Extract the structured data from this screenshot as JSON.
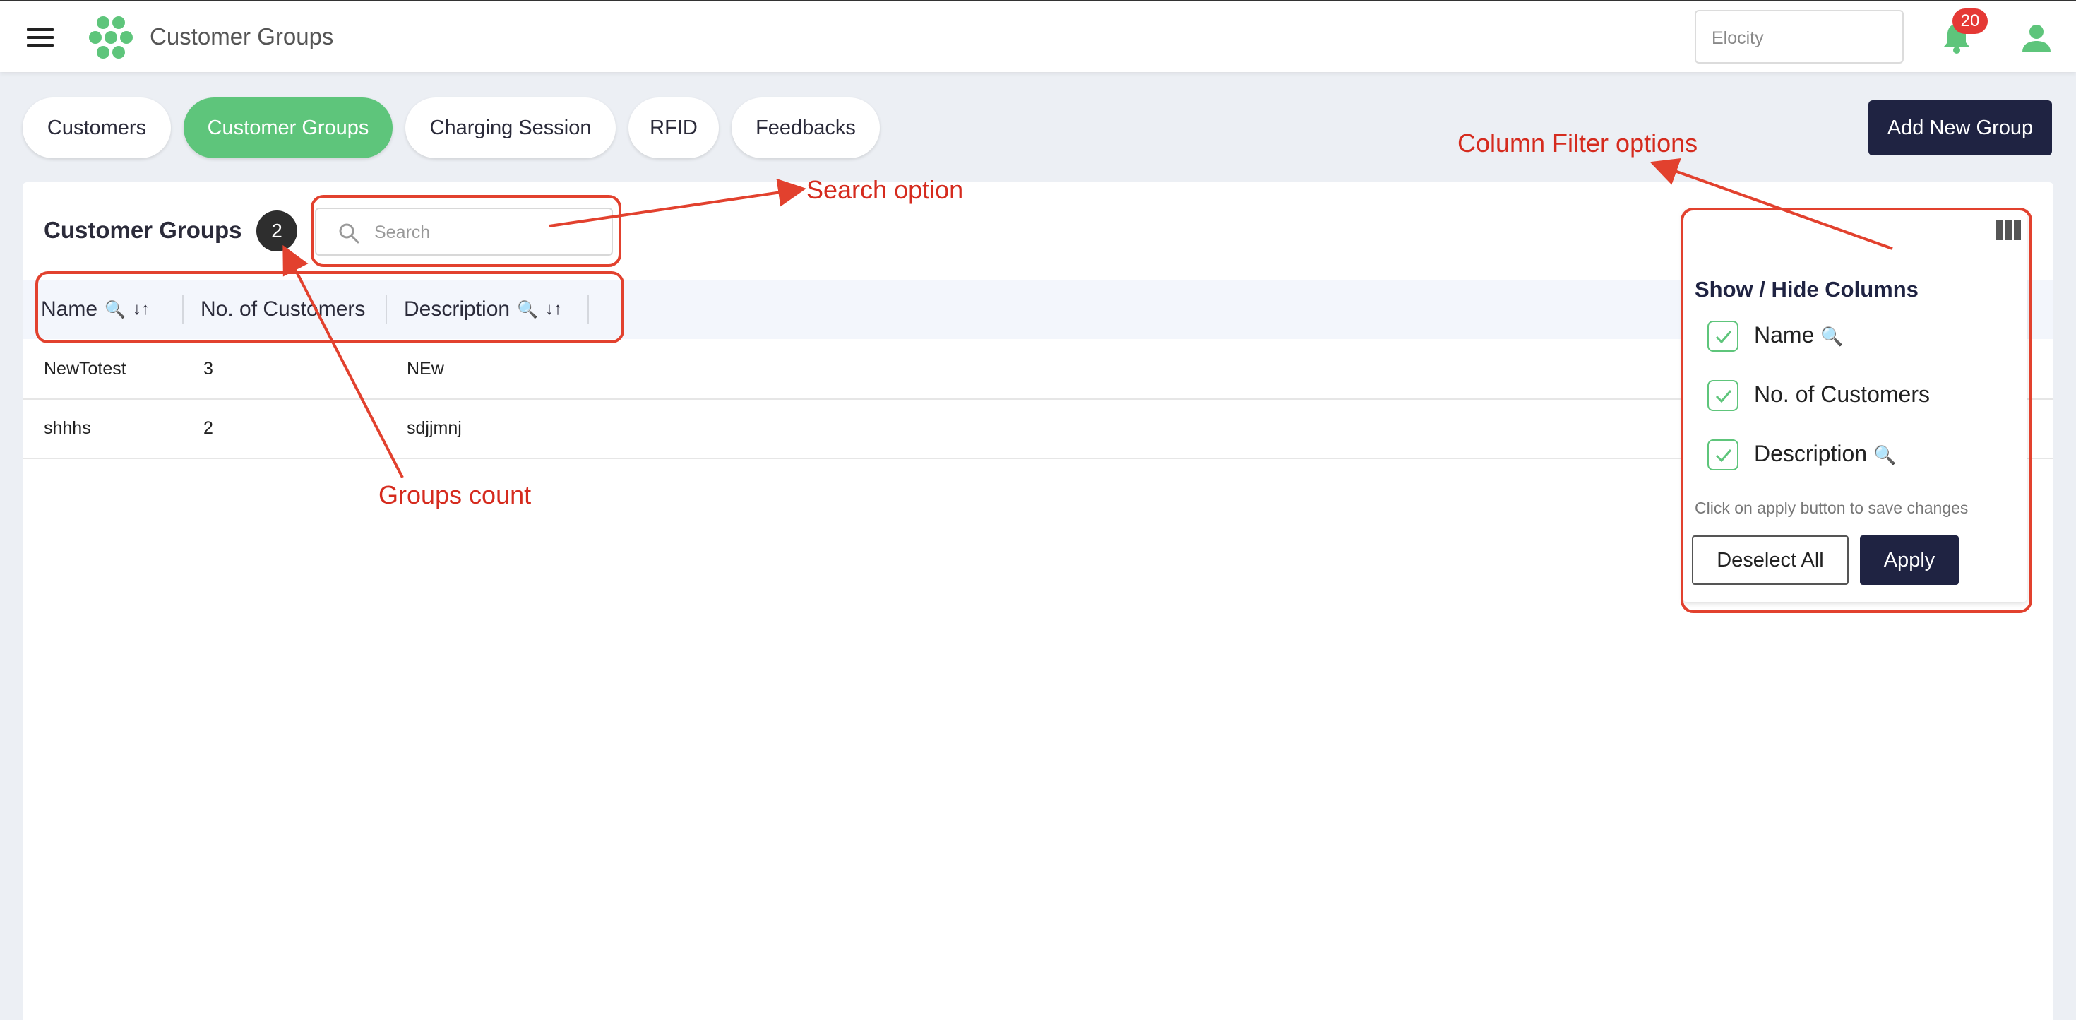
{
  "header": {
    "app_title": "Customer Groups",
    "org_select_value": "Elocity",
    "notification_count": "20"
  },
  "tabs": [
    {
      "label": "Customers",
      "active": false
    },
    {
      "label": "Customer Groups",
      "active": true
    },
    {
      "label": "Charging Session",
      "active": false
    },
    {
      "label": "RFID",
      "active": false
    },
    {
      "label": "Feedbacks",
      "active": false
    }
  ],
  "toolbar": {
    "add_button_label": "Add New Group"
  },
  "panel": {
    "title": "Customer Groups",
    "count": "2",
    "search_placeholder": "Search"
  },
  "table": {
    "columns": [
      "Name",
      "No. of Customers",
      "Description"
    ],
    "rows": [
      [
        "NewTotest",
        "3",
        "NEw"
      ],
      [
        "shhhs",
        "2",
        "sdjjmnj"
      ]
    ]
  },
  "column_filter": {
    "title": "Show / Hide Columns",
    "options": [
      {
        "label": "Name",
        "checked": true,
        "searchable": true
      },
      {
        "label": "No. of Customers",
        "checked": true,
        "searchable": false
      },
      {
        "label": "Description",
        "checked": true,
        "searchable": true
      }
    ],
    "hint": "Click on apply button to save changes",
    "deselect_label": "Deselect All",
    "apply_label": "Apply"
  },
  "annotations": {
    "search_option": "Search option",
    "column_filter_options": "Column Filter options",
    "groups_count": "Groups count"
  },
  "colors": {
    "accent_green": "#5ec57b",
    "navy": "#1f2342",
    "annotation_red": "#e2412e",
    "badge_red": "#e53935"
  }
}
